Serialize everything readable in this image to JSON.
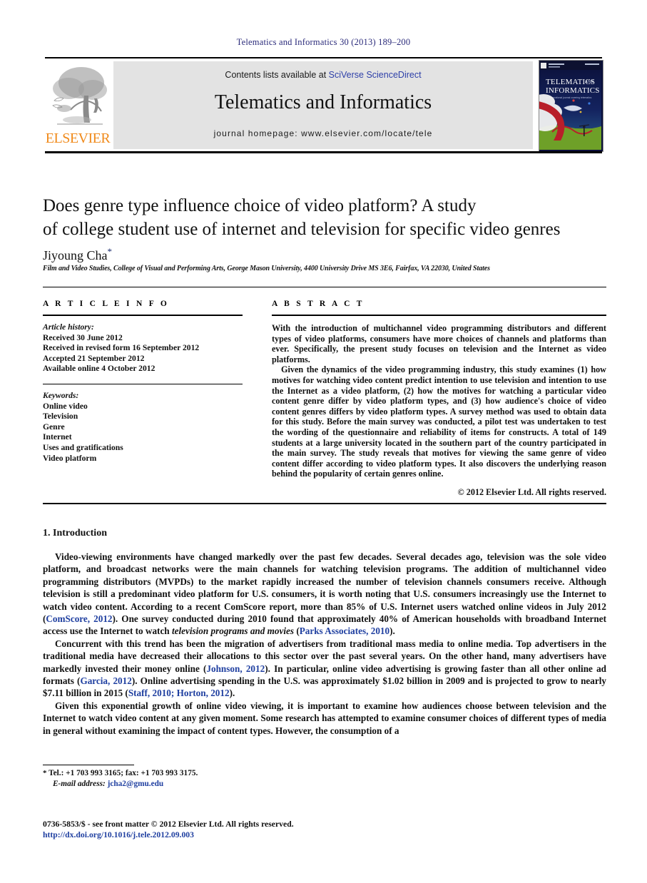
{
  "running_head": "Telematics and Informatics 30 (2013) 189–200",
  "masthead": {
    "contents_prefix": "Contents lists available at ",
    "contents_link": "SciVerse ScienceDirect",
    "journal_title": "Telematics and Informatics",
    "homepage": "journal homepage: www.elsevier.com/locate/tele",
    "publisher_name": "ELSEVIER",
    "cover_title_line1": "TELEMATICS",
    "cover_title_and": "AND",
    "cover_title_line2": "INFORMATICS",
    "cover_subtitle": "an international journal covering telematics and informatics"
  },
  "article": {
    "title_line1": "Does genre type influence choice of video platform? A study",
    "title_line2": "of college student use of internet and television for specific video genres",
    "author": "Jiyoung Cha",
    "author_marker": "*",
    "affiliation": "Film and Video Studies, College of Visual and Performing Arts, George Mason University, 4400 University Drive MS 3E6, Fairfax, VA 22030, United States"
  },
  "article_info": {
    "heading": "A R T I C L E    I N F O",
    "history_label": "Article history:",
    "history": [
      "Received 30 June 2012",
      "Received in revised form 16 September 2012",
      "Accepted 21 September 2012",
      "Available online 4 October 2012"
    ],
    "keywords_label": "Keywords:",
    "keywords": [
      "Online video",
      "Television",
      "Genre",
      "Internet",
      "Uses and gratifications",
      "Video platform"
    ]
  },
  "abstract": {
    "heading": "A B S T R A C T",
    "paragraph_1": "With the introduction of multichannel video programming distributors and different types of video platforms, consumers have more choices of channels and platforms than ever. Specifically, the present study focuses on television and the Internet as video platforms.",
    "paragraph_2": "Given the dynamics of the video programming industry, this study examines (1) how motives for watching video content predict intention to use television and intention to use the Internet as a video platform, (2) how the motives for watching a particular video content genre differ by video platform types, and (3) how audience's choice of video content genres differs by video platform types. A survey method was used to obtain data for this study. Before the main survey was conducted, a pilot test was undertaken to test the wording of the questionnaire and reliability of items for constructs. A total of 149 students at a large university located in the southern part of the country participated in the main survey. The study reveals that motives for viewing the same genre of video content differ according to video platform types. It also discovers the underlying reason behind the popularity of certain genres online.",
    "copyright": "© 2012 Elsevier Ltd. All rights reserved."
  },
  "body": {
    "section_heading": "1. Introduction",
    "paragraph_1_a": "Video-viewing environments have changed markedly over the past few decades. Several decades ago, television was the sole video platform, and broadcast networks were the main channels for watching television programs. The addition of multichannel video programming distributors (MVPDs) to the market rapidly increased the number of television channels consumers receive. Although television is still a predominant video platform for U.S. consumers, it is worth noting that U.S. consumers increasingly use the Internet to watch video content. According to a recent ComScore report, more than 85% of U.S. Internet users watched online videos in July 2012 (",
    "paragraph_1_ref1": "ComScore, 2012",
    "paragraph_1_b": "). One survey conducted during 2010 found that approximately 40% of American households with broadband Internet access use the Internet to watch ",
    "paragraph_1_italic": "television programs and movies",
    "paragraph_1_c": " (",
    "paragraph_1_ref2": "Parks Associates, 2010",
    "paragraph_1_d": ").",
    "paragraph_2_a": "Concurrent with this trend has been the migration of advertisers from traditional mass media to online media. Top advertisers in the traditional media have decreased their allocations to this sector over the past several years. On the other hand, many advertisers have markedly invested their money online (",
    "paragraph_2_ref1": "Johnson, 2012",
    "paragraph_2_b": "). In particular, online video advertising is growing faster than all other online ad formats (",
    "paragraph_2_ref2": "Garcia, 2012",
    "paragraph_2_c": "). Online advertising spending in the U.S. was approximately $1.02 billion in 2009 and is projected to grow to nearly $7.11 billion in 2015 (",
    "paragraph_2_ref3": "Staff, 2010; Horton, 2012",
    "paragraph_2_d": ").",
    "paragraph_3": "Given this exponential growth of online video viewing, it is important to examine how audiences choose between television and the Internet to watch video content at any given moment. Some research has attempted to examine consumer choices of different types of media in general without examining the impact of content types. However, the consumption of a"
  },
  "footer": {
    "corresponding_marker": "*",
    "tel_fax": "Tel.: +1 703 993 3165; fax: +1 703 993 3175.",
    "email_label": "E-mail address:",
    "email": "jcha2@gmu.edu",
    "issn_line": "0736-5853/$ - see front matter © 2012 Elsevier Ltd. All rights reserved.",
    "doi": "http://dx.doi.org/10.1016/j.tele.2012.09.003"
  },
  "colors": {
    "link": "#1f3fa0",
    "elsevier_orange": "#f08a1b",
    "sciencedirect_blue": "#2d3fa8",
    "runhead_blue": "#2a2a7a",
    "band_gray": "#e3e3e3"
  }
}
